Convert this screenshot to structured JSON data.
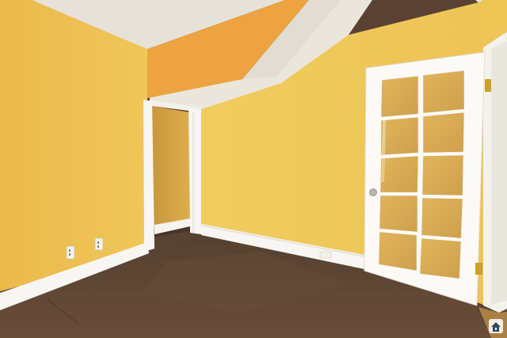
{
  "scene": {
    "colors": {
      "ceiling": "#e6e3dc",
      "wall_left": "#edc052",
      "wall_right": "#f2ca58",
      "soffit_orange": "#eca23f",
      "soffit_under": "#ebe6dc",
      "closet_inside": "#d6a443",
      "trim": "#f7f6f2",
      "carpet": "#5c4333",
      "carpet_dark": "#4a3427",
      "door_glass": "#d9ab55",
      "door_frame": "#fbfaf7",
      "hinge": "#c9a227",
      "outlet": "#f3f1ea"
    },
    "elements": [
      "ceiling",
      "left-wall",
      "right-wall",
      "soffit",
      "closet-opening",
      "french-door",
      "carpet-floor",
      "baseboards",
      "wall-outlets",
      "corner-logo-icon"
    ]
  }
}
